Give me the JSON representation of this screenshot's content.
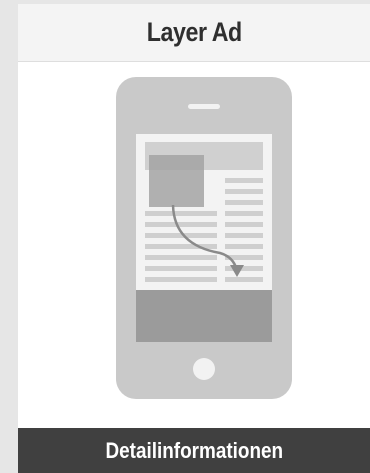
{
  "card": {
    "title": "Layer Ad",
    "illustration_icon": "smartphone-layer-ad-icon",
    "button_label": "Detailinformationen"
  },
  "colors": {
    "page_background": "#e6e6e6",
    "card_background": "#ffffff",
    "header_background": "#f4f4f4",
    "phone_body": "#c9c9c9",
    "phone_screen": "#f3f3f3",
    "layer_box": "#9b9b9b",
    "button_background": "#404040",
    "button_text": "#ffffff",
    "title_text": "#2f2f2f"
  }
}
